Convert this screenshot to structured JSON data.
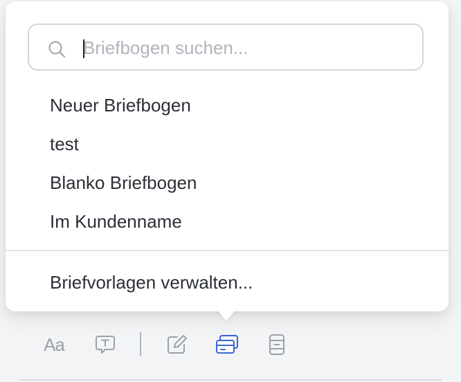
{
  "search": {
    "placeholder": "Briefbogen suchen...",
    "value": ""
  },
  "letterheads": [
    {
      "label": "Neuer Briefbogen"
    },
    {
      "label": "test"
    },
    {
      "label": "Blanko Briefbogen"
    },
    {
      "label": "Im Kundenname"
    }
  ],
  "footer": {
    "manage_label": "Briefvorlagen verwalten..."
  },
  "toolbar": {
    "text_style_label": "Aa",
    "active_tool": "letterhead",
    "icons": [
      "text-style-icon",
      "comment-text-icon",
      "edit-icon",
      "letterhead-icon",
      "page-layout-icon"
    ]
  },
  "colors": {
    "active": "#3b63d6",
    "inactive": "#9ba0a8",
    "text": "#2b2f36"
  }
}
